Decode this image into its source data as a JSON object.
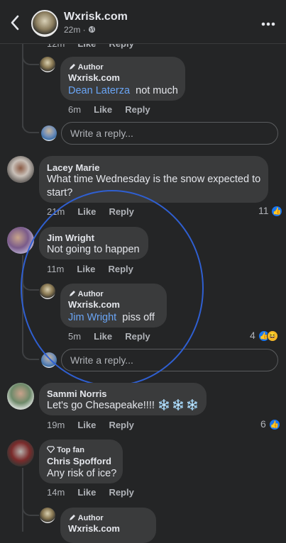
{
  "header": {
    "back_icon": "chevron-left-icon",
    "title": "Wxrisk.com",
    "meta": "22m · ",
    "globe_icon": "globe-icon",
    "more_icon": "more-dots-icon"
  },
  "top_partial": {
    "time": "12m",
    "like": "Like",
    "reply": "Reply"
  },
  "reply_1": {
    "badge": "Author",
    "author": "Wxrisk.com",
    "mention": "Dean Laterza",
    "text": "not much",
    "time": "6m",
    "like": "Like",
    "reply": "Reply"
  },
  "write_1": {
    "placeholder": "Write a reply..."
  },
  "comment_lacey": {
    "author": "Lacey Marie",
    "text": "What time Wednesday is the snow expected to start?",
    "time": "21m",
    "like": "Like",
    "reply": "Reply",
    "reactions": "11"
  },
  "comment_jim": {
    "author": "Jim Wright",
    "text": "Not going to happen",
    "time": "11m",
    "like": "Like",
    "reply": "Reply"
  },
  "reply_2": {
    "badge": "Author",
    "author": "Wxrisk.com",
    "mention": "Jim Wright",
    "text": "piss off",
    "time": "5m",
    "like": "Like",
    "reply": "Reply",
    "reactions": "4"
  },
  "write_2": {
    "placeholder": "Write a reply..."
  },
  "comment_sammi": {
    "author": "Sammi Norris",
    "text": "Let's go Chesapeake!!!! ",
    "snow": "❄️❄️❄️",
    "time": "19m",
    "like": "Like",
    "reply": "Reply",
    "reactions": "6"
  },
  "comment_chris": {
    "badge": "Top fan",
    "author": "Chris Spofford",
    "text": "Any risk of ice?",
    "time": "14m",
    "like": "Like",
    "reply": "Reply"
  },
  "reply_3": {
    "badge": "Author",
    "author": "Wxrisk.com"
  },
  "colors": {
    "background": "#242526",
    "bubble": "#3a3b3c",
    "mention": "#6aa5f5",
    "like_blue": "#1877f2",
    "annotation_circle": "#2f5fd1"
  }
}
